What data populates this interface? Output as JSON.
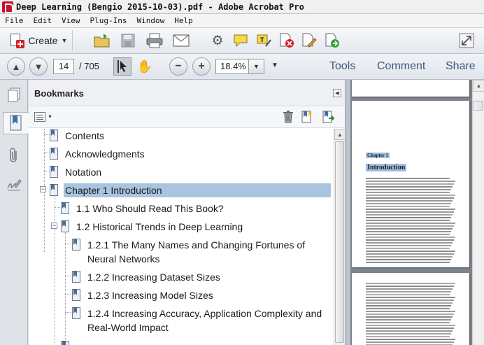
{
  "window": {
    "title": "Deep Learning (Bengio 2015-10-03).pdf - Adobe Acrobat Pro"
  },
  "menu": [
    "File",
    "Edit",
    "View",
    "Plug-Ins",
    "Window",
    "Help"
  ],
  "toolbar": {
    "create_label": "Create",
    "icons": [
      "open-folder-icon",
      "save-icon",
      "print-icon",
      "email-icon",
      "gear-icon",
      "comment-icon",
      "highlight-icon",
      "sign-icon",
      "redact-icon",
      "share-icon",
      "export-icon",
      "fullscreen-icon"
    ]
  },
  "navigation": {
    "current_page": "14",
    "total_pages": "/ 705",
    "zoom": "18.4%"
  },
  "panes": {
    "tools": "Tools",
    "comment": "Comment",
    "share": "Share"
  },
  "bookmarks": {
    "title": "Bookmarks",
    "items": [
      {
        "label": "Contents",
        "level": 0
      },
      {
        "label": "Acknowledgments",
        "level": 0
      },
      {
        "label": "Notation",
        "level": 0
      },
      {
        "label": "Chapter 1 Introduction",
        "level": 0,
        "expanded": true,
        "selected": true
      },
      {
        "label": "1.1 Who Should Read This Book?",
        "level": 1
      },
      {
        "label": "1.2 Historical Trends in Deep Learning",
        "level": 1,
        "expanded": true
      },
      {
        "label": "1.2.1 The Many Names and Changing Fortunes of Neural Networks",
        "level": 2
      },
      {
        "label": "1.2.2 Increasing Dataset Sizes",
        "level": 2
      },
      {
        "label": "1.2.3 Increasing Model Sizes",
        "level": 2
      },
      {
        "label": "1.2.4 Increasing Accuracy, Application Complexity and Real-World Impact",
        "level": 2
      }
    ]
  },
  "document": {
    "chapter_label": "Chapter 1",
    "heading": "Introduction"
  },
  "colors": {
    "selection": "#a9c4de",
    "pane_link": "#3d5a80",
    "doc_background": "#7f858c"
  }
}
